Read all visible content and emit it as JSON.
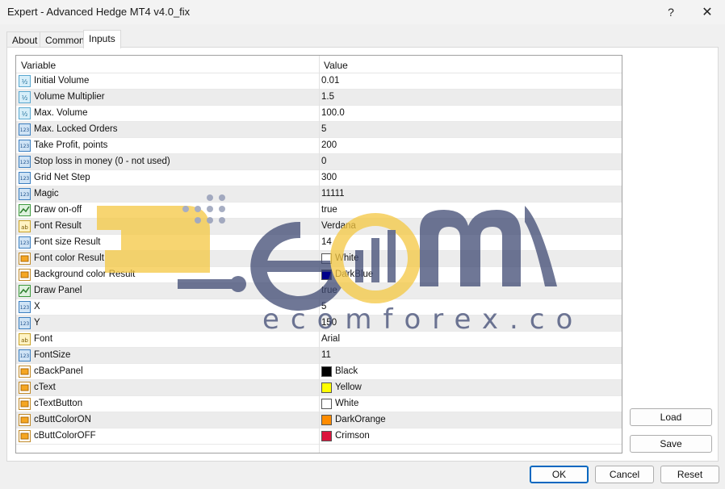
{
  "window": {
    "title": "Expert - Advanced Hedge MT4 v4.0_fix",
    "help_glyph": "?",
    "close_glyph": "✕"
  },
  "tabs": [
    {
      "label": "About",
      "active": false
    },
    {
      "label": "Common",
      "active": false
    },
    {
      "label": "Inputs",
      "active": true
    }
  ],
  "table": {
    "headers": {
      "variable": "Variable",
      "value": "Value"
    },
    "rows": [
      {
        "icon": "double-type-icon",
        "name": "Initial Volume",
        "value": "0.01"
      },
      {
        "icon": "double-type-icon",
        "name": "Volume Multiplier",
        "value": "1.5"
      },
      {
        "icon": "double-type-icon",
        "name": "Max. Volume",
        "value": "100.0"
      },
      {
        "icon": "integer-type-icon",
        "name": "Max. Locked Orders",
        "value": "5"
      },
      {
        "icon": "integer-type-icon",
        "name": "Take Profit, points",
        "value": "200"
      },
      {
        "icon": "integer-type-icon",
        "name": "Stop loss in money (0 - not used)",
        "value": "0"
      },
      {
        "icon": "integer-type-icon",
        "name": "Grid Net Step",
        "value": "300"
      },
      {
        "icon": "integer-type-icon",
        "name": "Magic",
        "value": "11111"
      },
      {
        "icon": "bool-type-icon",
        "name": "Draw on-off",
        "value": "true"
      },
      {
        "icon": "string-type-icon",
        "name": "Font Result",
        "value": "Verdana"
      },
      {
        "icon": "integer-type-icon",
        "name": "Font size Result",
        "value": "14"
      },
      {
        "icon": "color-type-icon",
        "name": "Font color Result",
        "value": "White",
        "swatch": "#ffffff"
      },
      {
        "icon": "color-type-icon",
        "name": "Background color Result",
        "value": "DarkBlue",
        "swatch": "#00008b"
      },
      {
        "icon": "bool-type-icon",
        "name": "Draw Panel",
        "value": "true"
      },
      {
        "icon": "integer-type-icon",
        "name": "X",
        "value": "5"
      },
      {
        "icon": "integer-type-icon",
        "name": "Y",
        "value": "150"
      },
      {
        "icon": "string-type-icon",
        "name": "Font",
        "value": "Arial"
      },
      {
        "icon": "integer-type-icon",
        "name": "FontSize",
        "value": "11"
      },
      {
        "icon": "color-type-icon",
        "name": "cBackPanel",
        "value": "Black",
        "swatch": "#000000"
      },
      {
        "icon": "color-type-icon",
        "name": "cText",
        "value": "Yellow",
        "swatch": "#ffff00"
      },
      {
        "icon": "color-type-icon",
        "name": "cTextButton",
        "value": "White",
        "swatch": "#ffffff"
      },
      {
        "icon": "color-type-icon",
        "name": "cButtColorON",
        "value": "DarkOrange",
        "swatch": "#ff8c00"
      },
      {
        "icon": "color-type-icon",
        "name": "cButtColorOFF",
        "value": "Crimson",
        "swatch": "#dc143c"
      }
    ]
  },
  "side_buttons": {
    "load": "Load",
    "save": "Save"
  },
  "footer_buttons": {
    "ok": "OK",
    "cancel": "Cancel",
    "reset": "Reset"
  },
  "watermark": {
    "text": "ecomforex.com",
    "colors": {
      "yellow": "#f5c842",
      "slate": "#3f4a73"
    }
  }
}
